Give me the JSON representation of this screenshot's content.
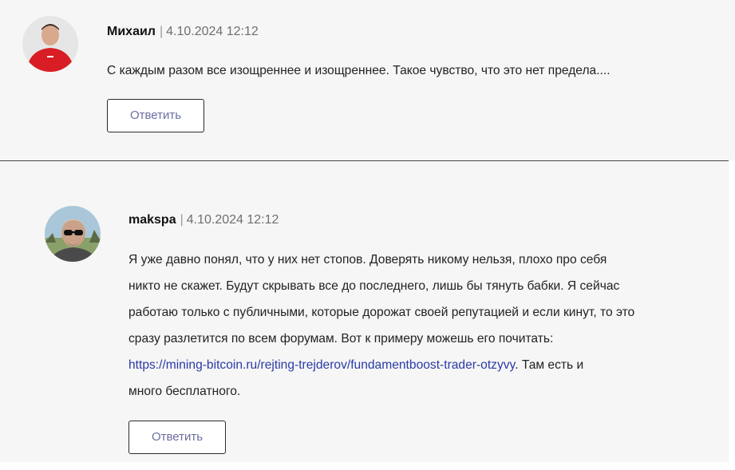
{
  "comments": [
    {
      "author": "Михаил",
      "separator": "|",
      "date": "4.10.2024 12:12",
      "text": "С каждым разом все изощреннее и изощреннее. Такое чувство, что это нет предела....",
      "reply_label": "Ответить",
      "avatar_icon": "avatar-man-red-shirt"
    },
    {
      "author": "makspa",
      "separator": "|",
      "date": "4.10.2024 12:12",
      "lines": [
        "Я уже давно понял, что у них нет стопов. Доверять никому нельзя, плохо про себя",
        "никто не скажет. Будут скрывать все до последнего, лишь бы тянуть бабки. Я сейчас",
        "работаю только с публичными, которые дорожат своей репутацией и если кинут, то это",
        "сразу разлетится по всем форумам. Вот к примеру можешь его почитать:"
      ],
      "link_text": "https://mining-bitcoin.ru/rejting-trejderov/fundamentboost-trader-otzyvy",
      "after_link": ". Там есть и",
      "last_line": "много бесплатного.",
      "reply_label": "Ответить",
      "avatar_icon": "avatar-man-sunglasses"
    }
  ],
  "colors": {
    "background": "#f6f6f6",
    "divider": "#444444",
    "link": "#2a3aa6",
    "button_text": "#6a6fa0"
  }
}
